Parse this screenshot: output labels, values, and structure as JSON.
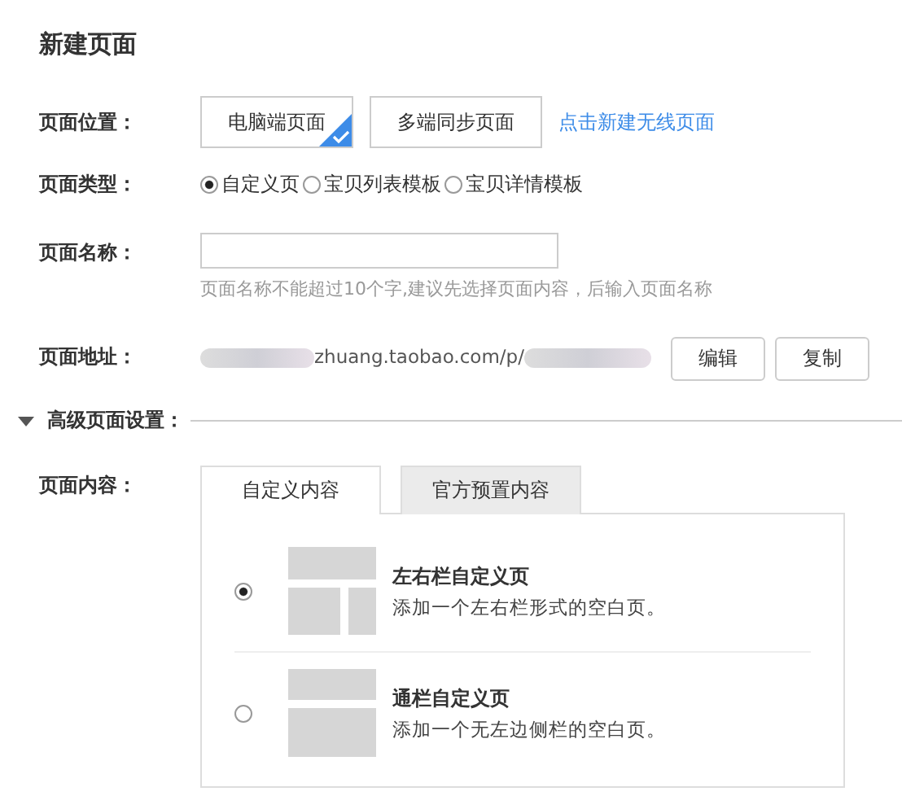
{
  "title": "新建页面",
  "position": {
    "label": "页面位置：",
    "options": [
      {
        "label": "电脑端页面",
        "selected": true
      },
      {
        "label": "多端同步页面",
        "selected": false
      }
    ],
    "link": "点击新建无线页面"
  },
  "type": {
    "label": "页面类型：",
    "options": [
      {
        "label": "自定义页",
        "selected": true
      },
      {
        "label": "宝贝列表模板",
        "selected": false
      },
      {
        "label": "宝贝详情模板",
        "selected": false
      }
    ]
  },
  "name": {
    "label": "页面名称：",
    "hint": "页面名称不能超过10个字,建议先选择页面内容，后输入页面名称"
  },
  "address": {
    "label": "页面地址：",
    "url": "zhuang.taobao.com/p/",
    "buttons": [
      "编辑",
      "复制"
    ]
  },
  "advanced": {
    "label": "高级页面设置：",
    "expanded": true
  },
  "content": {
    "label": "页面内容：",
    "tabs": [
      {
        "label": "自定义内容",
        "selected": true
      },
      {
        "label": "官方预置内容",
        "selected": false
      }
    ],
    "layouts": [
      {
        "kind": "two-column",
        "title": "左右栏自定义页",
        "desc": "添加一个左右栏形式的空白页。",
        "selected": true
      },
      {
        "kind": "full-width",
        "title": "通栏自定义页",
        "desc": "添加一个无左边侧栏的空白页。",
        "selected": false
      }
    ]
  }
}
